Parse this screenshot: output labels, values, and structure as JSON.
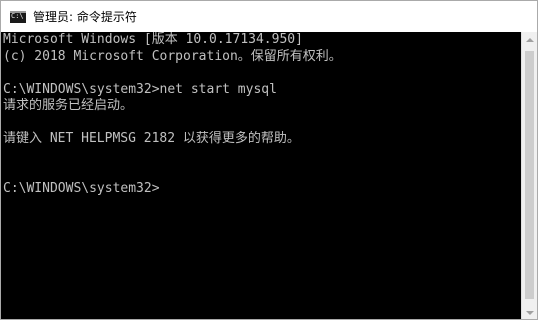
{
  "window": {
    "title": "管理员: 命令提示符",
    "icon_name": "command-prompt-icon",
    "icon_glyph": "C:\\"
  },
  "console": {
    "lines": [
      "Microsoft Windows [版本 10.0.17134.950]",
      "(c) 2018 Microsoft Corporation。保留所有权利。",
      "",
      "C:\\WINDOWS\\system32>net start mysql",
      "请求的服务已经启动。",
      "",
      "请键入 NET HELPMSG 2182 以获得更多的帮助。",
      "",
      "",
      "C:\\WINDOWS\\system32>"
    ]
  },
  "colors": {
    "console_background": "#000000",
    "console_text": "#c0c0c0",
    "titlebar_background": "#ffffff"
  }
}
